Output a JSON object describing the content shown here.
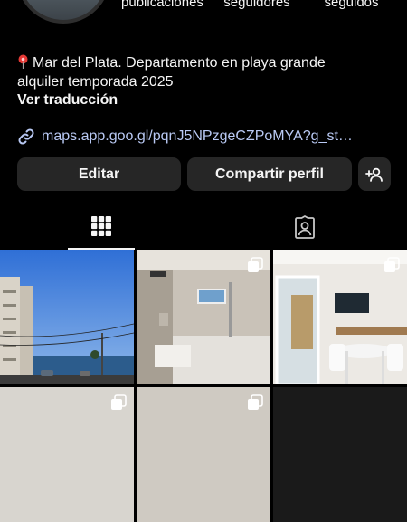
{
  "profile": {
    "stats": [
      {
        "label": "publicaciones"
      },
      {
        "label": "seguidores"
      },
      {
        "label": "seguidos"
      }
    ],
    "bio_line1": "Mar del Plata. Departamento en playa grande",
    "bio_line2": "alquiler temporada 2025",
    "translate_label": "Ver traducción",
    "link_text": "maps.app.goo.gl/pqnJ5NPzgeCZPoMYA?g_st…"
  },
  "actions": {
    "edit_label": "Editar",
    "share_label": "Compartir perfil"
  },
  "tabs": [
    {
      "icon": "grid-icon",
      "active": true
    },
    {
      "icon": "tagged-icon",
      "active": false
    }
  ],
  "posts": [
    {
      "subject": "city-beach-view",
      "multi": false
    },
    {
      "subject": "bathroom",
      "multi": true
    },
    {
      "subject": "living-room",
      "multi": true
    },
    {
      "subject": "post-4",
      "multi": true
    },
    {
      "subject": "post-5",
      "multi": true
    },
    {
      "subject": "post-6",
      "multi": false
    }
  ],
  "colors": {
    "background": "#000000",
    "button": "#262626",
    "link": "#b9c9f4",
    "text": "#f5f5f5"
  }
}
